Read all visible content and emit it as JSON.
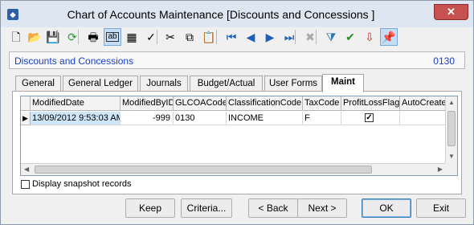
{
  "window": {
    "title": "Chart of Accounts Maintenance  [Discounts and Concessions  ]",
    "close_label": "✕"
  },
  "toolbar": {
    "buttons": [
      {
        "name": "new-icon",
        "glyph": "🗋"
      },
      {
        "name": "open-folder-icon",
        "glyph": "📂"
      },
      {
        "name": "save-icon",
        "glyph": "💾"
      },
      {
        "name": "refresh-icon",
        "glyph": "⟳"
      },
      {
        "name": "print-icon",
        "glyph": "🖶"
      },
      {
        "name": "field-view-icon",
        "glyph": "ab"
      },
      {
        "name": "calculator-icon",
        "glyph": "▦"
      },
      {
        "name": "spellcheck-icon",
        "glyph": "✓"
      },
      {
        "name": "cut-icon",
        "glyph": "✂"
      },
      {
        "name": "copy-icon",
        "glyph": "⧉"
      },
      {
        "name": "paste-icon",
        "glyph": "📋"
      },
      {
        "name": "first-record-icon",
        "glyph": "⏮"
      },
      {
        "name": "previous-record-icon",
        "glyph": "◀"
      },
      {
        "name": "next-record-icon",
        "glyph": "▶"
      },
      {
        "name": "last-record-icon",
        "glyph": "⏭"
      },
      {
        "name": "delete-icon",
        "glyph": "✖"
      },
      {
        "name": "filter-icon",
        "glyph": "⧩"
      },
      {
        "name": "approve-icon",
        "glyph": "✔"
      },
      {
        "name": "import-icon",
        "glyph": "⇩"
      },
      {
        "name": "pin-icon",
        "glyph": "📌"
      }
    ]
  },
  "record": {
    "name": "Discounts and Concessions",
    "code": "0130"
  },
  "tabs": [
    "General",
    "General Ledger",
    "Journals",
    "Budget/Actual",
    "User Forms",
    "Maint"
  ],
  "active_tab": "Maint",
  "grid": {
    "columns": [
      "ModifiedDate",
      "ModifiedByID",
      "GLCOACode",
      "ClassificationCode",
      "TaxCode",
      "ProfitLossFlag",
      "AutoCreate"
    ],
    "rows": [
      {
        "ModifiedDate": "13/09/2012 9:53:03 AM",
        "ModifiedByID": "-999",
        "GLCOACode": "0130",
        "ClassificationCode": "INCOME",
        "TaxCode": "F",
        "ProfitLossFlag": "✓",
        "AutoCreate": ""
      }
    ]
  },
  "snapshot": {
    "label": "Display snapshot records",
    "checked": false
  },
  "buttons": {
    "keep": "Keep",
    "criteria": "Criteria...",
    "back": "< Back",
    "next": "Next >",
    "ok": "OK",
    "exit": "Exit"
  },
  "colors": {
    "record_text": "#1a3fc0",
    "titlebar": "#dde6f1",
    "selection": "#cfe5f8"
  }
}
